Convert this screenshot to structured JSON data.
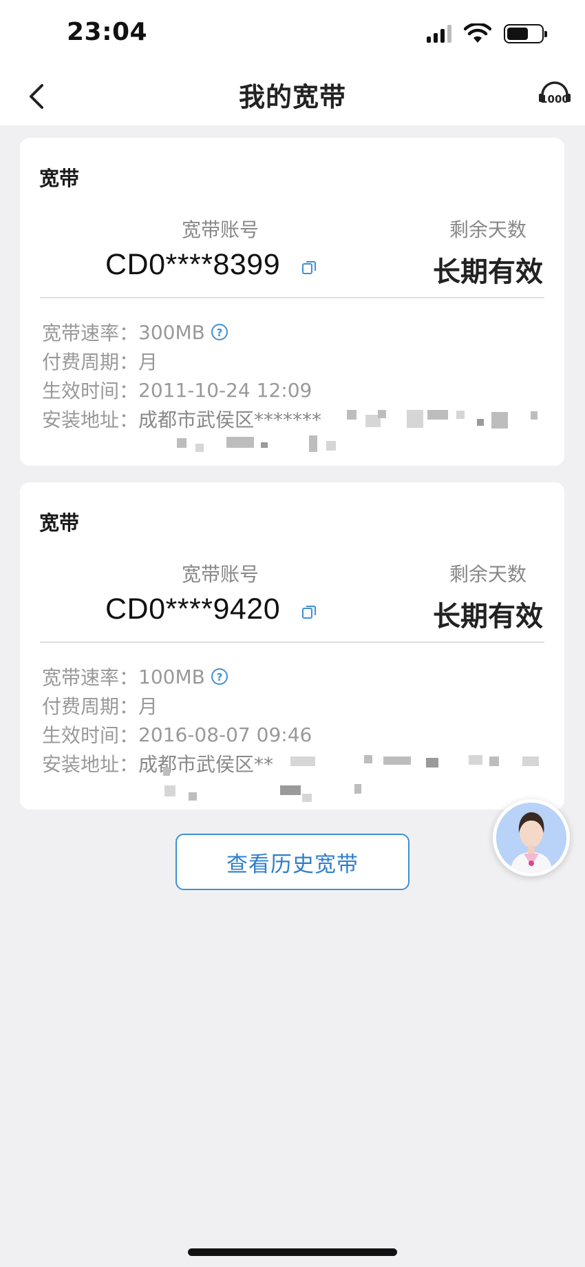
{
  "status_bar": {
    "time": "23:04"
  },
  "nav": {
    "title": "我的宽带"
  },
  "cards": [
    {
      "title": "宽带",
      "account_label": "宽带账号",
      "account_value": "CD0****8399",
      "days_label": "剩余天数",
      "days_value": "长期有效",
      "speed_label": "宽带速率：",
      "speed_value": "300MB",
      "period_label": "付费周期：",
      "period_value": "月",
      "effective_label": "生效时间：",
      "effective_value": "2011-10-24 12:09",
      "address_label": "安装地址：",
      "address_value": "成都市武侯区*******"
    },
    {
      "title": "宽带",
      "account_label": "宽带账号",
      "account_value": "CD0****9420",
      "days_label": "剩余天数",
      "days_value": "长期有效",
      "speed_label": "宽带速率：",
      "speed_value": "100MB",
      "period_label": "付费周期：",
      "period_value": "月",
      "effective_label": "生效时间：",
      "effective_value": "2016-08-07 09:46",
      "address_label": "安装地址：",
      "address_value": "成都市武侯区**"
    }
  ],
  "history_button": "查看历史宽带",
  "colors": {
    "accent": "#2f7fca",
    "background": "#f0f0f2",
    "card": "#ffffff"
  },
  "icons": {
    "back": "chevron-left-icon",
    "service": "service-10000-icon",
    "copy": "copy-icon",
    "help": "help-icon"
  }
}
